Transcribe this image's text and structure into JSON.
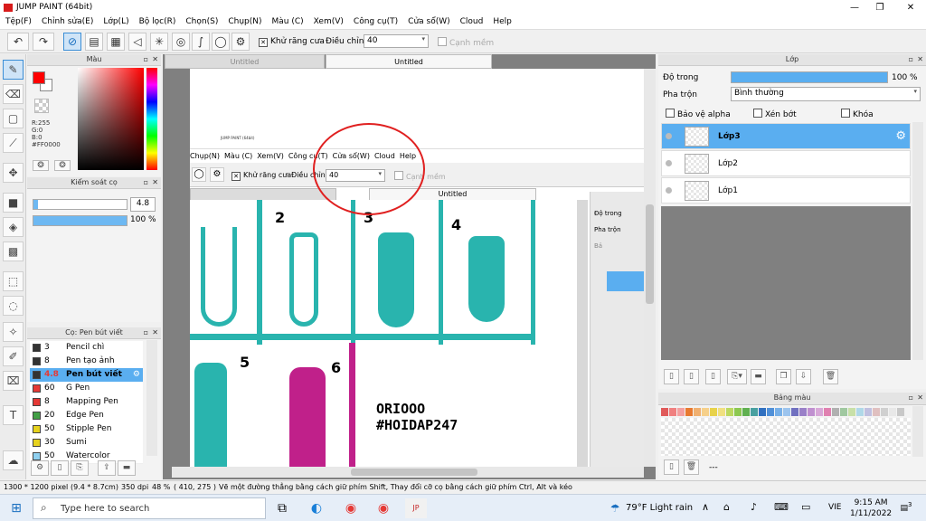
{
  "app": {
    "title": "JUMP PAINT (64bit)"
  },
  "window_buttons": {
    "minimize": "—",
    "maximize": "❐",
    "close": "✕"
  },
  "menu": [
    "Tệp(F)",
    "Chỉnh sửa(E)",
    "Lớp(L)",
    "Bộ lọc(R)",
    "Chọn(S)",
    "Chụp(N)",
    "Màu (C)",
    "Xem(V)",
    "Công cụ(T)",
    "Cửa sổ(W)",
    "Cloud",
    "Help"
  ],
  "toolbar": {
    "antialias_label": "Khử răng cưa",
    "adjust_label": "Điều chỉnh",
    "adjust_value": "40",
    "smooth_label": "Cạnh mềm"
  },
  "color_panel": {
    "title": "Màu",
    "r": "R:255",
    "g": "G:0",
    "b": "B:0",
    "hex": "#FF0000",
    "fg_color": "#ff0000",
    "bg_color": "#ffffff"
  },
  "brush_control": {
    "title": "Kiểm soát cọ",
    "size": "4.8",
    "opacity": "100 %",
    "opacity_fraction": 1.0
  },
  "pen_panel": {
    "title": "Cọ: Pen bút viết",
    "items": [
      {
        "size": "3",
        "name": "Pencil chì",
        "color": "#333333",
        "selected": false
      },
      {
        "size": "8",
        "name": "Pen tạo ảnh",
        "color": "#333333",
        "selected": false
      },
      {
        "size": "4.8",
        "name": "Pen bút viết",
        "color": "#333333",
        "selected": true
      },
      {
        "size": "60",
        "name": "G Pen",
        "color": "#e53935",
        "selected": false
      },
      {
        "size": "8",
        "name": "Mapping Pen",
        "color": "#e53935",
        "selected": false
      },
      {
        "size": "20",
        "name": "Edge Pen",
        "color": "#43a047",
        "selected": false
      },
      {
        "size": "50",
        "name": "Stipple Pen",
        "color": "#e6d21e",
        "selected": false
      },
      {
        "size": "30",
        "name": "Sumi",
        "color": "#e6d21e",
        "selected": false
      },
      {
        "size": "50",
        "name": "Watercolor",
        "color": "#8fd0f0",
        "selected": false
      }
    ]
  },
  "canvas": {
    "tabs": [
      "Untitled",
      "Untitled"
    ],
    "inner_menu": [
      "Chụp(N)",
      "Màu (C)",
      "Xem(V)",
      "Công cụ(T)",
      "Cửa sổ(W)",
      "Cloud",
      "Help"
    ],
    "inner_toolbar": {
      "antialias": "Khử răng cưa",
      "adjust": "Điều chỉnh",
      "value": "40",
      "smooth": "Cạnh mềm"
    },
    "inner_tab": "Untitled",
    "inner_right": [
      "Độ trong",
      "Pha trộn",
      "Bả"
    ],
    "frame_numbers": [
      "2",
      "3",
      "4",
      "5",
      "6"
    ],
    "signature": [
      "ORIOOO",
      "#HOIDAP247"
    ],
    "inner_title": "JUMP PAINT (64bit)"
  },
  "layers_panel": {
    "title": "Lớp",
    "opacity_label": "Độ trong",
    "opacity_value": "100 %",
    "opacity_fraction": 1.0,
    "blend_label": "Pha trộn",
    "blend_value": "Bình thường",
    "protect_alpha": "Bảo vệ alpha",
    "clip": "Xén bớt",
    "lock": "Khóa",
    "layers": [
      {
        "name": "Lớp3",
        "selected": true
      },
      {
        "name": "Lớp2",
        "selected": false
      },
      {
        "name": "Lớp1",
        "selected": false
      }
    ]
  },
  "palette_panel": {
    "title": "Bảng màu",
    "swatches": [
      "#e05a5a",
      "#f08080",
      "#f4a0a0",
      "#e87a30",
      "#f0b070",
      "#f6d08a",
      "#e8d24a",
      "#f0e080",
      "#bcd860",
      "#8cc850",
      "#60b050",
      "#48a0a0",
      "#3070c0",
      "#5090d8",
      "#78b0e8",
      "#9cc4ee",
      "#7070c0",
      "#9a80c8",
      "#c090d0",
      "#d8a8d8",
      "#e080b0",
      "#b0b0b0",
      "#a0c8a0",
      "#c8e0a8",
      "#b0d8e8",
      "#c0c0e0",
      "#e0c0c0",
      "#d0d0d0",
      "#e8e8e8",
      "#c8c8c8"
    ],
    "more": "---"
  },
  "status": {
    "size": "1300 * 1200 pixel",
    "cm": "(9.4 * 8.7cm)",
    "dpi": "350 dpi",
    "zoom": "48 %",
    "coords": "( 410, 275 )",
    "hint": "Vẽ một đường thẳng bằng cách giữ phím Shift, Thay đổi cỡ cọ bằng cách giữ phím Ctrl, Alt và kéo"
  },
  "taskbar": {
    "search_placeholder": "Type here to search",
    "weather": "79°F  Light rain",
    "lang": "VIE",
    "time": "9:15 AM",
    "date": "1/11/2022",
    "notif": "3"
  }
}
